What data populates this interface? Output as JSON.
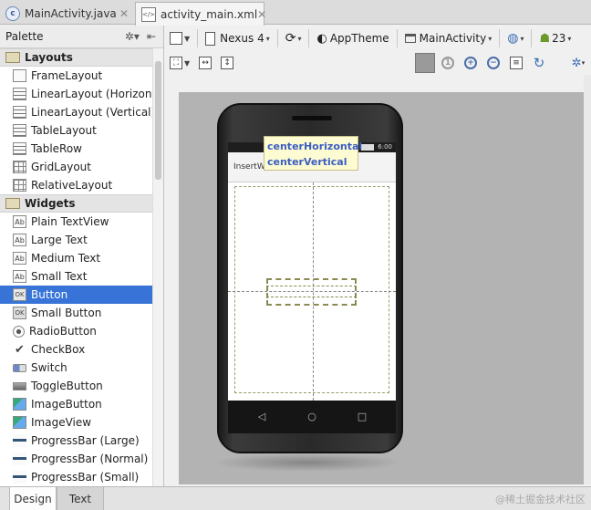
{
  "file_tabs": [
    {
      "label": "MainActivity.java",
      "icon": "java-class-icon"
    },
    {
      "label": "activity_main.xml",
      "icon": "xml-file-icon"
    }
  ],
  "palette": {
    "title": "Palette",
    "items": [
      {
        "label": "Layouts",
        "kind": "category"
      },
      {
        "label": "FrameLayout",
        "icon": "frame-layout-icon"
      },
      {
        "label": "LinearLayout (Horizontal)",
        "icon": "linear-layout-icon"
      },
      {
        "label": "LinearLayout (Vertical)",
        "icon": "linear-layout-icon"
      },
      {
        "label": "TableLayout",
        "icon": "table-layout-icon"
      },
      {
        "label": "TableRow",
        "icon": "table-row-icon"
      },
      {
        "label": "GridLayout",
        "icon": "grid-layout-icon"
      },
      {
        "label": "RelativeLayout",
        "icon": "relative-layout-icon"
      },
      {
        "label": "Widgets",
        "kind": "category"
      },
      {
        "label": "Plain TextView",
        "icon": "textview-icon"
      },
      {
        "label": "Large Text",
        "icon": "textview-icon"
      },
      {
        "label": "Medium Text",
        "icon": "textview-icon"
      },
      {
        "label": "Small Text",
        "icon": "textview-icon"
      },
      {
        "label": "Button",
        "icon": "button-icon",
        "selected": true
      },
      {
        "label": "Small Button",
        "icon": "button-icon"
      },
      {
        "label": "RadioButton",
        "icon": "radio-icon"
      },
      {
        "label": "CheckBox",
        "icon": "checkbox-icon"
      },
      {
        "label": "Switch",
        "icon": "switch-icon"
      },
      {
        "label": "ToggleButton",
        "icon": "toggle-icon"
      },
      {
        "label": "ImageButton",
        "icon": "image-icon"
      },
      {
        "label": "ImageView",
        "icon": "image-icon"
      },
      {
        "label": "ProgressBar (Large)",
        "icon": "progressbar-icon"
      },
      {
        "label": "ProgressBar (Normal)",
        "icon": "progressbar-icon"
      },
      {
        "label": "ProgressBar (Small)",
        "icon": "progressbar-icon"
      }
    ]
  },
  "toolbar": {
    "device": "Nexus 4",
    "theme": "AppTheme",
    "activity": "MainActivity",
    "api_level": "23"
  },
  "preview": {
    "action_bar_title": "InsertW",
    "status_time": "6:00",
    "tooltip_lines": [
      "centerHorizontal",
      "centerVertical"
    ]
  },
  "bottom_tabs": {
    "design": "Design",
    "text": "Text"
  },
  "watermark": "@稀土掘金技术社区",
  "colors": {
    "selection": "#3874d8",
    "tooltip_text": "#3a5ec2",
    "tooltip_bg": "#fdfbd2",
    "canvas_bg": "#b3b3b3"
  }
}
